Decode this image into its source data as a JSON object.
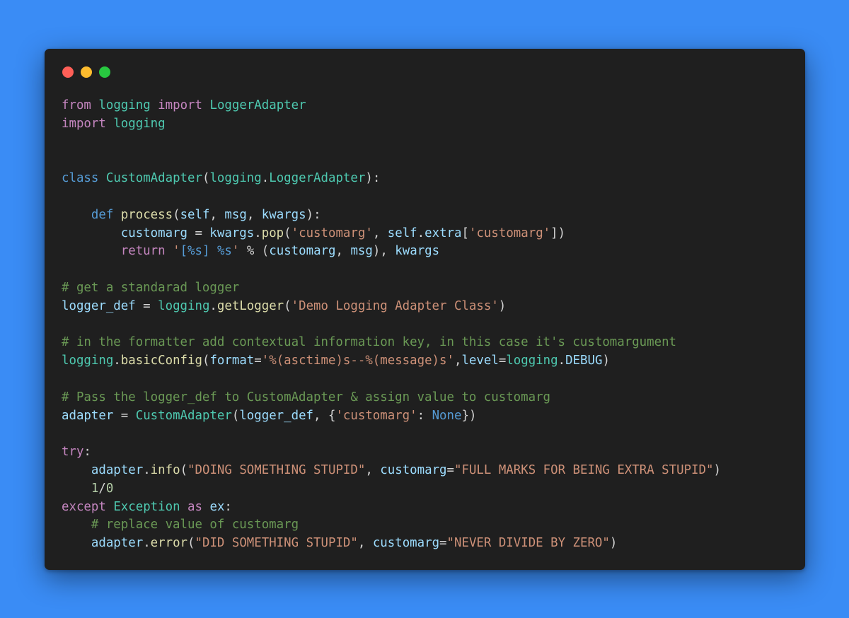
{
  "window": {
    "controls": [
      {
        "name": "close",
        "color": "#ff5f57"
      },
      {
        "name": "minimize",
        "color": "#febc2e"
      },
      {
        "name": "zoom",
        "color": "#28c840"
      }
    ]
  },
  "code": {
    "language": "python",
    "lines": [
      [
        [
          "k",
          "from"
        ],
        [
          "p",
          " "
        ],
        [
          "t",
          "logging"
        ],
        [
          "p",
          " "
        ],
        [
          "k",
          "import"
        ],
        [
          "p",
          " "
        ],
        [
          "t",
          "LoggerAdapter"
        ]
      ],
      [
        [
          "k",
          "import"
        ],
        [
          "p",
          " "
        ],
        [
          "t",
          "logging"
        ]
      ],
      [],
      [],
      [
        [
          "s",
          "class"
        ],
        [
          "p",
          " "
        ],
        [
          "t",
          "CustomAdapter"
        ],
        [
          "p",
          "("
        ],
        [
          "t",
          "logging"
        ],
        [
          "p",
          "."
        ],
        [
          "t",
          "LoggerAdapter"
        ],
        [
          "p",
          "):"
        ]
      ],
      [],
      [
        [
          "p",
          "    "
        ],
        [
          "s",
          "def"
        ],
        [
          "p",
          " "
        ],
        [
          "f",
          "process"
        ],
        [
          "p",
          "("
        ],
        [
          "v",
          "self"
        ],
        [
          "p",
          ", "
        ],
        [
          "v",
          "msg"
        ],
        [
          "p",
          ", "
        ],
        [
          "v",
          "kwargs"
        ],
        [
          "p",
          "):"
        ]
      ],
      [
        [
          "p",
          "        "
        ],
        [
          "v",
          "customarg"
        ],
        [
          "p",
          " = "
        ],
        [
          "v",
          "kwargs"
        ],
        [
          "p",
          "."
        ],
        [
          "f",
          "pop"
        ],
        [
          "p",
          "("
        ],
        [
          "str",
          "'customarg'"
        ],
        [
          "p",
          ", "
        ],
        [
          "v",
          "self"
        ],
        [
          "p",
          "."
        ],
        [
          "v",
          "extra"
        ],
        [
          "p",
          "["
        ],
        [
          "str",
          "'customarg'"
        ],
        [
          "p",
          "])"
        ]
      ],
      [
        [
          "p",
          "        "
        ],
        [
          "k",
          "return"
        ],
        [
          "p",
          " "
        ],
        [
          "str",
          "'"
        ],
        [
          "s",
          "[%s]"
        ],
        [
          "str",
          " "
        ],
        [
          "s",
          "%s"
        ],
        [
          "str",
          "'"
        ],
        [
          "p",
          " % ("
        ],
        [
          "v",
          "customarg"
        ],
        [
          "p",
          ", "
        ],
        [
          "v",
          "msg"
        ],
        [
          "p",
          "), "
        ],
        [
          "v",
          "kwargs"
        ]
      ],
      [],
      [
        [
          "c",
          "# get a standarad logger"
        ]
      ],
      [
        [
          "v",
          "logger_def"
        ],
        [
          "p",
          " = "
        ],
        [
          "t",
          "logging"
        ],
        [
          "p",
          "."
        ],
        [
          "f",
          "getLogger"
        ],
        [
          "p",
          "("
        ],
        [
          "str",
          "'Demo Logging Adapter Class'"
        ],
        [
          "p",
          ")"
        ]
      ],
      [],
      [
        [
          "c",
          "# in the formatter add contextual information key, in this case it's customargument"
        ]
      ],
      [
        [
          "t",
          "logging"
        ],
        [
          "p",
          "."
        ],
        [
          "f",
          "basicConfig"
        ],
        [
          "p",
          "("
        ],
        [
          "v",
          "format"
        ],
        [
          "p",
          "="
        ],
        [
          "str",
          "'%(asctime)s--%(message)s'"
        ],
        [
          "p",
          ","
        ],
        [
          "v",
          "level"
        ],
        [
          "p",
          "="
        ],
        [
          "t",
          "logging"
        ],
        [
          "p",
          "."
        ],
        [
          "v",
          "DEBUG"
        ],
        [
          "p",
          ")"
        ]
      ],
      [],
      [
        [
          "c",
          "# Pass the logger_def to CustomAdapter & assign value to customarg"
        ]
      ],
      [
        [
          "v",
          "adapter"
        ],
        [
          "p",
          " = "
        ],
        [
          "t",
          "CustomAdapter"
        ],
        [
          "p",
          "("
        ],
        [
          "v",
          "logger_def"
        ],
        [
          "p",
          ", {"
        ],
        [
          "str",
          "'customarg'"
        ],
        [
          "p",
          ": "
        ],
        [
          "s",
          "None"
        ],
        [
          "p",
          "})"
        ]
      ],
      [],
      [
        [
          "k",
          "try"
        ],
        [
          "p",
          ":"
        ]
      ],
      [
        [
          "p",
          "    "
        ],
        [
          "v",
          "adapter"
        ],
        [
          "p",
          "."
        ],
        [
          "f",
          "info"
        ],
        [
          "p",
          "("
        ],
        [
          "str",
          "\"DOING SOMETHING STUPID\""
        ],
        [
          "p",
          ", "
        ],
        [
          "v",
          "customarg"
        ],
        [
          "p",
          "="
        ],
        [
          "str",
          "\"FULL MARKS FOR BEING EXTRA STUPID\""
        ],
        [
          "p",
          ")"
        ]
      ],
      [
        [
          "p",
          "    "
        ],
        [
          "n",
          "1"
        ],
        [
          "p",
          "/"
        ],
        [
          "n",
          "0"
        ]
      ],
      [
        [
          "k",
          "except"
        ],
        [
          "p",
          " "
        ],
        [
          "t",
          "Exception"
        ],
        [
          "p",
          " "
        ],
        [
          "k",
          "as"
        ],
        [
          "p",
          " "
        ],
        [
          "v",
          "ex"
        ],
        [
          "p",
          ":"
        ]
      ],
      [
        [
          "p",
          "    "
        ],
        [
          "c",
          "# replace value of customarg"
        ]
      ],
      [
        [
          "p",
          "    "
        ],
        [
          "v",
          "adapter"
        ],
        [
          "p",
          "."
        ],
        [
          "f",
          "error"
        ],
        [
          "p",
          "("
        ],
        [
          "str",
          "\"DID SOMETHING STUPID\""
        ],
        [
          "p",
          ", "
        ],
        [
          "v",
          "customarg"
        ],
        [
          "p",
          "="
        ],
        [
          "str",
          "\"NEVER DIVIDE BY ZERO\""
        ],
        [
          "p",
          ")"
        ]
      ]
    ]
  }
}
